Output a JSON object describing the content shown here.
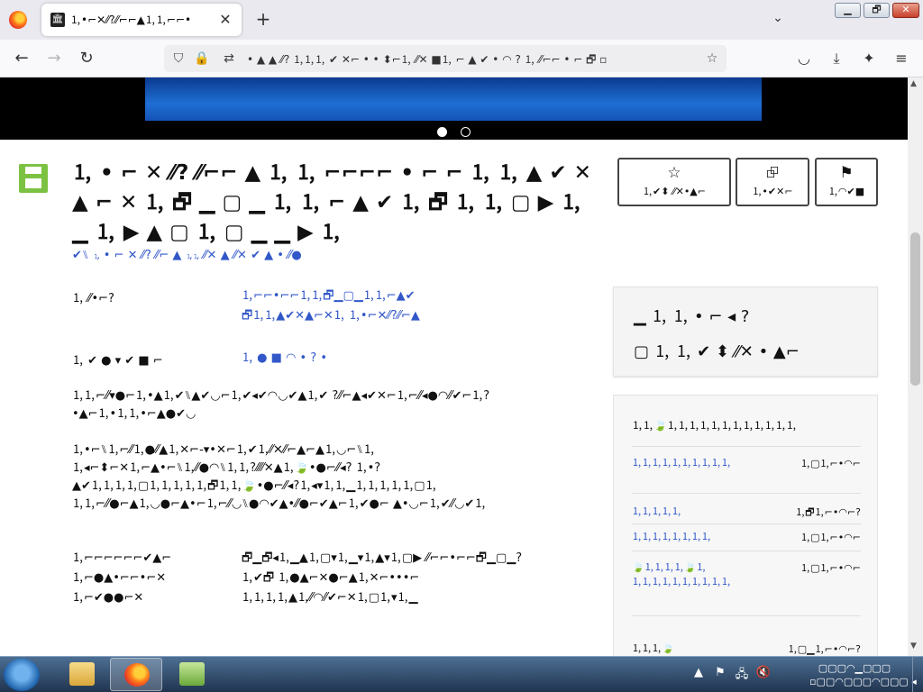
{
  "browser": {
    "tab_title": "🄂•⌐✕⁄⁄?⁄⁄⌐⌐▲🄂🄂⌐⌐•",
    "tab_close": "✕",
    "new_tab": "+",
    "tab_list": "⌄",
    "url": "• ▲ ▲ ⁄⁄? 🄂🄂🄂 ✔ ✕⌐ • • ⬍⌐🄂 ⁄⁄✕ ■🄂 ⌐ ▲ ✔ • ◠ ? 🄂 ⁄⁄⌐⌐ • ⌐ 🗗 ▫",
    "window_min": "▁",
    "window_max": "🗗",
    "window_close": "✕"
  },
  "nav": {
    "back": "←",
    "forward": "→",
    "reload": "↻",
    "shield": "⛉",
    "lock": "🔒",
    "permissions": "⇄",
    "star": "☆",
    "pocket": "◡",
    "downloads": "⤓",
    "extensions": "✦",
    "menu": "≡"
  },
  "article": {
    "title": "🄂 • ⌐ ✕ ⁄⁄? ⁄⁄⌐⌐ ▲ 🄂 🄂 ⌐⌐⌐⌐ • ⌐ ⌐ 🄂 🄂 ▲ ✔ ✕ ▲ ⌐ ✕ 🄂 🗗 ▁ ▢ ▁ 🄂 🄂 ⌐ ▲ ✔ 🄂 🗗 🄂 🄂 ▢ ▶ 🄂 ▁ 🄂 ▶ ▲ ▢ 🄂 ▢ ▁ ▁ ▶ 🄂",
    "byline": "✔⑊ 🄂 • ⌐ ✕ ⁄⁄? ⁄⁄⌐ ▲ 🄂🄂 ⁄⁄✕ ▲ ⁄⁄✕ ✔ ▲ • ⁄⁄●"
  },
  "actions": {
    "favorite": {
      "icon": "☆",
      "label": "🄂✔⬍ ⁄⁄✕•▲⌐"
    },
    "share": {
      "icon": "⮺",
      "label": "🄂•✔✕⌐"
    },
    "report": {
      "icon": "⚑",
      "label": "🄂◠✔■"
    }
  },
  "details": {
    "row1_label": "🄂 ⁄⁄•⌐?",
    "row1_value": "🄂⌐⌐•⌐⌐🄂🄂🗗▁▢▁🄂🄂⌐▲✔ 🗗🄂🄂▲✔✕▲⌐✕🄂 🄂•⌐✕⁄⁄?⁄⁄⌐▲",
    "row2_label": "🄂 ✔ ● ▾ ✔ ■ ⌐",
    "row2_value": "🄂 ● ■ ◠ • ? •"
  },
  "paragraphs": {
    "p1": "🄂🄂⌐⁄⁄▾●⌐🄂•▲🄂✔⑊▲✔◡⌐🄂✔◂✔◠◡✔▲🄂✔ ?⁄⁄⌐▲◂✔✕⌐🄂⌐⁄⁄◂●◠⁄⁄✔⌐🄂?•▲⌐🄂•🄂🄂•⌐▲●✔◡",
    "p2": "🄂•⌐⑊🄂⌐⁄⁄🄂●⁄⁄▲🄂✕⌐-▾•✕⌐🄂✔🄂⁄⁄✕⁄⁄⌐▲⌐▲🄂◡⌐⑊🄂 🄂◂⌐⬍⌐✕🄂⌐▲•⌐⑊🄂⁄⁄●◠⑊🄂🄂?⁄⁄⁄⁄✕▲🄂🍃•●⌐⁄⁄◂? 🄂•?▲✔🄂🄂🄂🄂▢🄂🄂🄂🄂🄂🗗🄂🄂🍃•●⌐⁄⁄◂?🄂◂▾🄂🄂▁🄂🄂🄂🄂🄂▢🄂 🄂🄂⌐⁄⁄●⌐▲🄂◡●⌐▲•⌐🄂⌐⁄⁄◡⑊●◠✔▲•⁄⁄●⌐✔▲⌐🄂✔●⌐ ▲•◡⌐🄂✔⁄⁄◡✔🄂"
  },
  "table": {
    "left": "🄂⌐⌐⌐⌐⌐⌐✔▲⌐ 🄂⌐●▲•⌐⌐•⌐✕ 🄂⌐✔●●⌐✕",
    "right": "🗗▁🗗◂🄂▁▲🄂▢▾🄂▁▾🄂▲▾🄂▢▶ ⁄⁄⌐⌐•⌐⌐🗗▁▢▁?🄂✔🗗 🄂●▲⌐✕●⌐▲🄂✕⌐•••⌐ 🄂🄂🄂🄂▲🄂⁄⁄◠⁄⁄✔⌐✕🄂▢🄂▾🄂▁"
  },
  "info_box": {
    "line1": "▁ 🄂 🄂 • ⌐ ◂ ?",
    "line2": "▢ 🄂 🄂 ✔ ⬍ ⁄⁄✕ • ▲⌐"
  },
  "list_box": {
    "heading": "🄂🄂🍃🄂🄂🄂🄂🄂🄂🄂🄂🄂🄂🄂🄂",
    "row1_title": "🄂🄂🄂🄂🄂🄂🄂🄂🄂🄂",
    "row1_meta": "🄂▢🄂⌐•◠⌐",
    "row2_title_a": "🄂🄂🄂🄂🄂",
    "row2_meta_a": "🄂🗗🄂⌐•◠⌐?",
    "row2_title_b": "🄂🄂🄂🄂🄂🄂🄂🄂",
    "row2_meta_b": "🄂▢🄂⌐•◠⌐",
    "row3_title_a": "🍃🄂🄂🄂🄂🍃🄂",
    "row3_title_b": "🄂🄂🄂🄂🄂🄂🄂🄂🄂🄂",
    "row3_meta": "🄂▢🄂⌐•◠⌐",
    "row4_title": "🄂🄂🄂🍃",
    "row4_meta": "🄂▢▁🄂⌐•◠⌐?"
  },
  "taskbar": {
    "tray_up": "▲",
    "tray_flag": "⚑",
    "tray_net": "🖧",
    "tray_vol": "🔇",
    "time": "▢▢▢◠▁▢▢▢",
    "date": "▫▢▢◠▢▢▢◠▢▢▢ ◂"
  }
}
